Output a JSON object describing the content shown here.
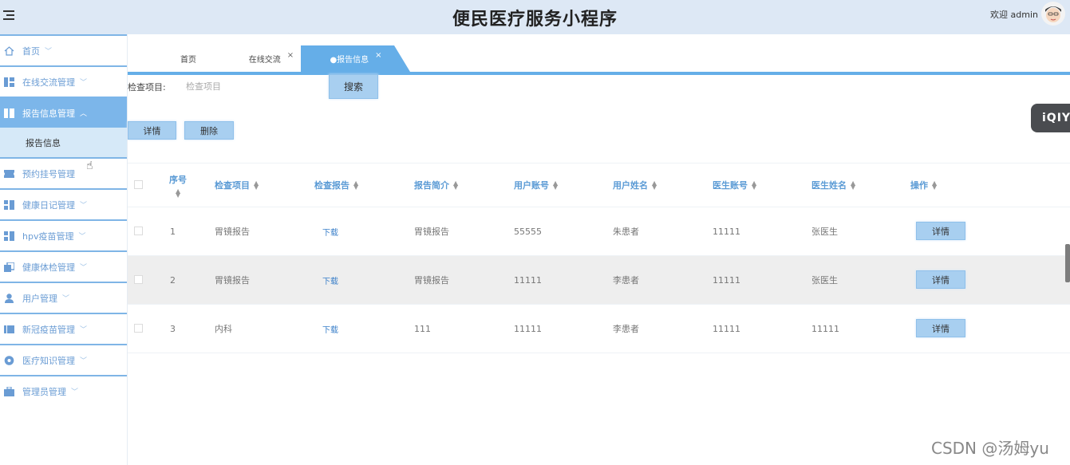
{
  "header": {
    "title": "便民医疗服务小程序",
    "welcome": "欢迎 admin"
  },
  "sidebar": {
    "items": [
      {
        "label": "首页",
        "icon": "home-icon",
        "expanded": false
      },
      {
        "label": "在线交流管理",
        "icon": "dashboard-icon",
        "expanded": false
      },
      {
        "label": "报告信息管理",
        "icon": "grid-icon",
        "expanded": true,
        "sub": [
          "报告信息"
        ]
      },
      {
        "label": "预约挂号管理",
        "icon": "ticket-icon",
        "expanded": false
      },
      {
        "label": "健康日记管理",
        "icon": "grid-icon",
        "expanded": false
      },
      {
        "label": "hpv疫苗管理",
        "icon": "grid-icon",
        "expanded": false
      },
      {
        "label": "健康体检管理",
        "icon": "copy-icon",
        "expanded": false
      },
      {
        "label": "用户管理",
        "icon": "user-icon",
        "expanded": false
      },
      {
        "label": "新冠疫苗管理",
        "icon": "book-icon",
        "expanded": false
      },
      {
        "label": "医疗知识管理",
        "icon": "disc-icon",
        "expanded": false
      },
      {
        "label": "管理员管理",
        "icon": "briefcase-icon",
        "expanded": false
      }
    ]
  },
  "tabs": [
    {
      "label": "首页",
      "closable": false
    },
    {
      "label": "在线交流",
      "closable": true
    },
    {
      "label": "●报告信息",
      "closable": true,
      "active": true
    }
  ],
  "close_glyph": "×",
  "search": {
    "label": "检查项目:",
    "placeholder": "检查项目",
    "button": "搜索"
  },
  "actions": {
    "detail": "详情",
    "delete": "删除"
  },
  "table": {
    "columns": [
      "序号",
      "检查项目",
      "检查报告",
      "报告简介",
      "用户账号",
      "用户姓名",
      "医生账号",
      "医生姓名",
      "操作"
    ],
    "rows": [
      {
        "seq": "1",
        "item": "胃镜报告",
        "report": "下载",
        "intro": "胃镜报告",
        "user_account": "55555",
        "user_name": "朱患者",
        "doctor_account": "11111",
        "doctor_name": "张医生",
        "op": "详情"
      },
      {
        "seq": "2",
        "item": "胃镜报告",
        "report": "下载",
        "intro": "胃镜报告",
        "user_account": "11111",
        "user_name": "李患者",
        "doctor_account": "11111",
        "doctor_name": "张医生",
        "op": "详情"
      },
      {
        "seq": "3",
        "item": "内科",
        "report": "下载",
        "intro": "111",
        "user_account": "11111",
        "user_name": "李患者",
        "doctor_account": "11111",
        "doctor_name": "11111",
        "op": "详情"
      }
    ]
  },
  "overlay": {
    "badge": "iQIY",
    "watermark": "CSDN @汤姆yu"
  },
  "colors": {
    "accent": "#65aee8",
    "header_bg": "#dde8f5",
    "button_bg": "#a8cff0",
    "link": "#3a7fc9"
  }
}
